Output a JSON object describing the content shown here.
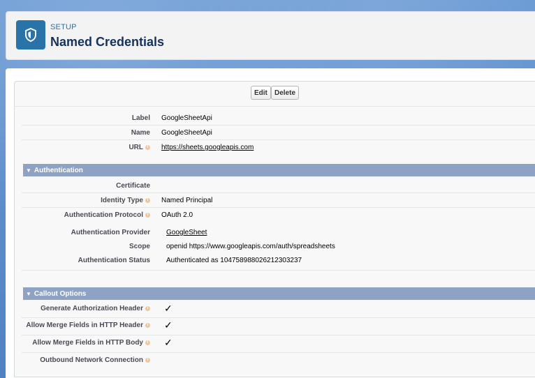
{
  "header": {
    "eyebrow": "SETUP",
    "title": "Named Credentials",
    "icon": "shield-icon"
  },
  "toolbar": {
    "edit_label": "Edit",
    "delete_label": "Delete"
  },
  "details": {
    "label": {
      "label": "Label",
      "value": "GoogleSheetApi"
    },
    "name": {
      "label": "Name",
      "value": "GoogleSheetApi"
    },
    "url": {
      "label": "URL",
      "value": "https://sheets.googleapis.com"
    }
  },
  "authentication": {
    "section_title": "Authentication",
    "certificate": {
      "label": "Certificate",
      "value": ""
    },
    "identity_type": {
      "label": "Identity Type",
      "value": "Named Principal"
    },
    "protocol": {
      "label": "Authentication Protocol",
      "value": "OAuth 2.0"
    },
    "provider": {
      "label": "Authentication Provider",
      "value": "GoogleSheet"
    },
    "scope": {
      "label": "Scope",
      "value": "openid https://www.googleapis.com/auth/spreadsheets"
    },
    "status": {
      "label": "Authentication Status",
      "value": "Authenticated as 104758988026212303237"
    }
  },
  "callout": {
    "section_title": "Callout Options",
    "generate_auth_header": {
      "label": "Generate Authorization Header",
      "checked": true
    },
    "merge_fields_header": {
      "label": "Allow Merge Fields in HTTP Header",
      "checked": true
    },
    "merge_fields_body": {
      "label": "Allow Merge Fields in HTTP Body",
      "checked": true
    },
    "outbound_connection": {
      "label": "Outbound Network Connection",
      "value": ""
    }
  },
  "glyphs": {
    "check": "✓",
    "collapse": "▼",
    "help": "i"
  },
  "colors": {
    "header_icon_bg": "#2a73a8",
    "section_bg": "#8ea2c4",
    "page_bg": "#5b8cc9"
  }
}
